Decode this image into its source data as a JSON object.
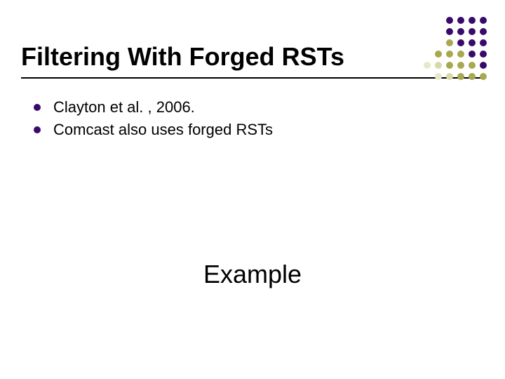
{
  "slide": {
    "title": "Filtering With Forged RSTs",
    "bullets": [
      "Clayton et al. , 2006.",
      "Comcast also uses forged RSTs"
    ],
    "example_label": "Example"
  },
  "decor": {
    "dot_colors": {
      "purple": "#3a0a6b",
      "olive": "#a8a850"
    }
  }
}
